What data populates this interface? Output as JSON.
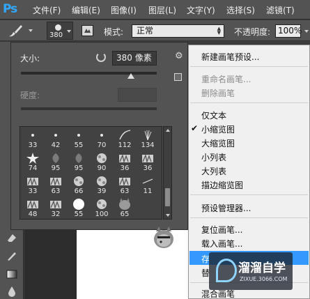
{
  "app": {
    "logo_text": "Ps"
  },
  "menubar": {
    "items": [
      "文件(F)",
      "编辑(E)",
      "图像(I)",
      "图层(L)",
      "文字(Y)",
      "选择(S)",
      "滤镜(T)"
    ]
  },
  "options_bar": {
    "brush_size": "380",
    "mode_label": "模式:",
    "mode_value": "正常",
    "opacity_label": "不透明度:",
    "opacity_value": "100%"
  },
  "brush_panel": {
    "size_label": "大小:",
    "size_value": "380 像素",
    "size_fraction": 0.81,
    "hardness_label": "硬度:",
    "brushes": [
      {
        "num": "33",
        "kind": "dot"
      },
      {
        "num": "42",
        "kind": "dot"
      },
      {
        "num": "55",
        "kind": "dot"
      },
      {
        "num": "70",
        "kind": "dot"
      },
      {
        "num": "112",
        "kind": "stroke"
      },
      {
        "num": "134",
        "kind": "spray"
      },
      {
        "num": "74",
        "kind": "star"
      },
      {
        "num": "95",
        "kind": "leaf"
      },
      {
        "num": "95",
        "kind": "leaf"
      },
      {
        "num": "90",
        "kind": "fuzz"
      },
      {
        "num": "36",
        "kind": "grass"
      },
      {
        "num": "36",
        "kind": "grass"
      },
      {
        "num": "33",
        "kind": "grass"
      },
      {
        "num": "63",
        "kind": "grass"
      },
      {
        "num": "66",
        "kind": "fuzz"
      },
      {
        "num": "39",
        "kind": "fuzz"
      },
      {
        "num": "63",
        "kind": "grass"
      },
      {
        "num": "11",
        "kind": "line"
      },
      {
        "num": "48",
        "kind": "grass"
      },
      {
        "num": "32",
        "kind": "grass"
      },
      {
        "num": "55",
        "kind": "round"
      },
      {
        "num": "100",
        "kind": "fuzz"
      },
      {
        "num": "65",
        "kind": "cat"
      },
      {
        "num": "",
        "kind": "blank"
      }
    ]
  },
  "context_menu": {
    "items": [
      {
        "label": "新建画笔预设...",
        "disabled": false,
        "checked": false
      },
      {
        "label": "重命名画笔...",
        "disabled": true,
        "checked": false
      },
      {
        "label": "删除画笔",
        "disabled": true,
        "checked": false
      },
      {
        "label": "仅文本",
        "disabled": false,
        "checked": false
      },
      {
        "label": "小缩览图",
        "disabled": false,
        "checked": true
      },
      {
        "label": "大缩览图",
        "disabled": false,
        "checked": false
      },
      {
        "label": "小列表",
        "disabled": false,
        "checked": false
      },
      {
        "label": "大列表",
        "disabled": false,
        "checked": false
      },
      {
        "label": "描边缩览图",
        "disabled": false,
        "checked": false
      },
      {
        "label": "预设管理器...",
        "disabled": false,
        "checked": false
      },
      {
        "label": "复位画笔...",
        "disabled": false,
        "checked": false
      },
      {
        "label": "载入画笔...",
        "disabled": false,
        "checked": false
      },
      {
        "label": "存",
        "disabled": false,
        "checked": false
      },
      {
        "label": "替",
        "disabled": false,
        "checked": false
      },
      {
        "label": "混合画笔",
        "disabled": false,
        "checked": false
      }
    ],
    "highlight_color": "#3399ff"
  },
  "watermark": {
    "title": "溜溜自学",
    "url": "ZIXUE.3066.COM"
  },
  "colors": {
    "ui_panel": "#535353",
    "menu_bg": "#f0f0f0",
    "ps_blue": "#30a8ff"
  }
}
